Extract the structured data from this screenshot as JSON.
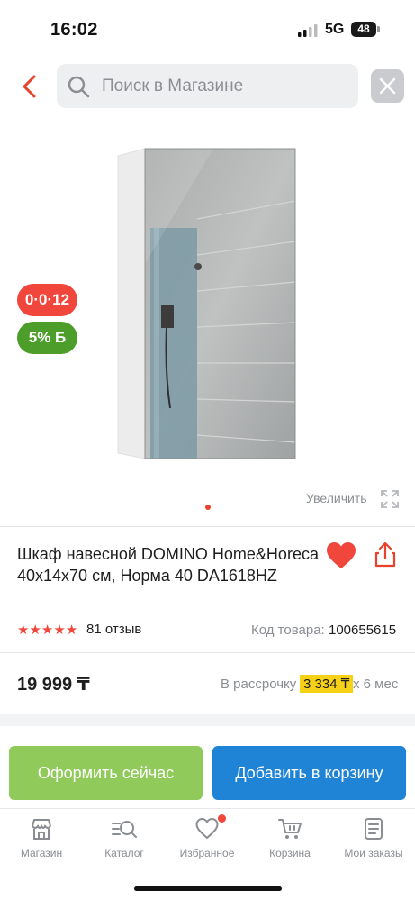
{
  "status_bar": {
    "time": "16:02",
    "network": "5G",
    "battery": "48"
  },
  "header": {
    "back_icon": "chevron-left-icon",
    "search_placeholder": "Поиск в Магазине",
    "clear_icon": "close-icon"
  },
  "gallery": {
    "badge_installment": "0·0·12",
    "badge_bonus": "5% Б",
    "zoom_label": "Увеличить",
    "slides_total": 1,
    "current_slide": 1
  },
  "product": {
    "title": "Шкаф навесной DOMINO Home&Horeca 40x14x70 см, Норма 40 DA1618HZ",
    "rating_stars": 5,
    "reviews": "81 отзыв",
    "sku_label": "Код товара:",
    "sku_value": "100655615",
    "price": "19 999 ₸",
    "installment_prefix": "В рассрочку",
    "installment_amount": "3 334 ₸",
    "installment_term": "x 6 мес"
  },
  "actions": {
    "buy_now": "Оформить сейчас",
    "add_to_cart": "Добавить в корзину"
  },
  "bottom_nav": {
    "items": [
      {
        "label": "Магазин",
        "icon": "store-icon"
      },
      {
        "label": "Каталог",
        "icon": "catalog-search-icon"
      },
      {
        "label": "Избранное",
        "icon": "heart-icon",
        "has_notification": true
      },
      {
        "label": "Корзина",
        "icon": "cart-icon"
      },
      {
        "label": "Мои заказы",
        "icon": "orders-icon"
      }
    ]
  },
  "colors": {
    "accent_red": "#f0463b",
    "bonus_green": "#4d9d2a",
    "buy_now_green": "#8fca5a",
    "cart_blue": "#1f84d6",
    "installment_yellow": "#f7d117"
  }
}
